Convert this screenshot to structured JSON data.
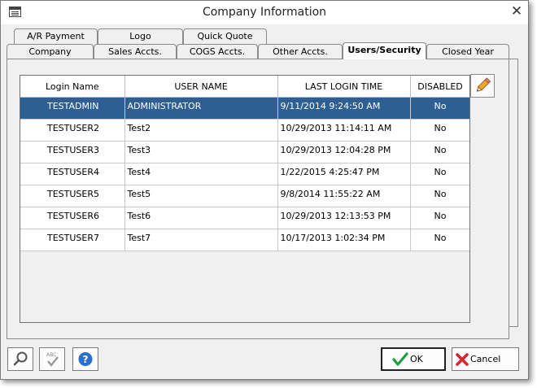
{
  "window": {
    "title": "Company Information"
  },
  "tabs_row_back": [
    {
      "label": "A/R Payment"
    },
    {
      "label": "Logo"
    },
    {
      "label": "Quick Quote"
    }
  ],
  "tabs_row_front": [
    {
      "label": "Company"
    },
    {
      "label": "Sales Accts."
    },
    {
      "label": "COGS Accts."
    },
    {
      "label": "Other Accts."
    },
    {
      "label": "Users/Security"
    },
    {
      "label": "Closed Year"
    }
  ],
  "selected_tab": "Users/Security",
  "table": {
    "columns": [
      "Login Name",
      "USER NAME",
      "LAST LOGIN TIME",
      "DISABLED"
    ],
    "rows": [
      [
        "TESTADMIN",
        "ADMINISTRATOR",
        "9/11/2014 9:24:50 AM",
        "No"
      ],
      [
        "TESTUSER2",
        "Test2",
        "10/29/2013 11:14:11 AM",
        "No"
      ],
      [
        "TESTUSER3",
        "Test3",
        "10/29/2013 12:04:28 PM",
        "No"
      ],
      [
        "TESTUSER4",
        "Test4",
        "1/22/2015 4:25:47 PM",
        "No"
      ],
      [
        "TESTUSER5",
        "Test5",
        "9/8/2014 11:55:22 AM",
        "No"
      ],
      [
        "TESTUSER6",
        "Test6",
        "10/29/2013 12:13:53 PM",
        "No"
      ],
      [
        "TESTUSER7",
        "Test7",
        "10/17/2013 1:02:34 PM",
        "No"
      ]
    ],
    "selected_row": 0
  },
  "buttons": {
    "ok": "OK",
    "cancel": "Cancel"
  },
  "colors": {
    "selection": "#2e5f93",
    "ok_check": "#1e9e3e",
    "cancel_x": "#d9262f",
    "help_blue": "#2a6fc9"
  },
  "icons": {
    "edit": "pencil-icon",
    "search": "magnifier-icon",
    "spellcheck": "spellcheck-icon",
    "help": "question-icon",
    "ok": "checkmark-icon",
    "cancel": "x-icon",
    "close": "close-icon"
  }
}
